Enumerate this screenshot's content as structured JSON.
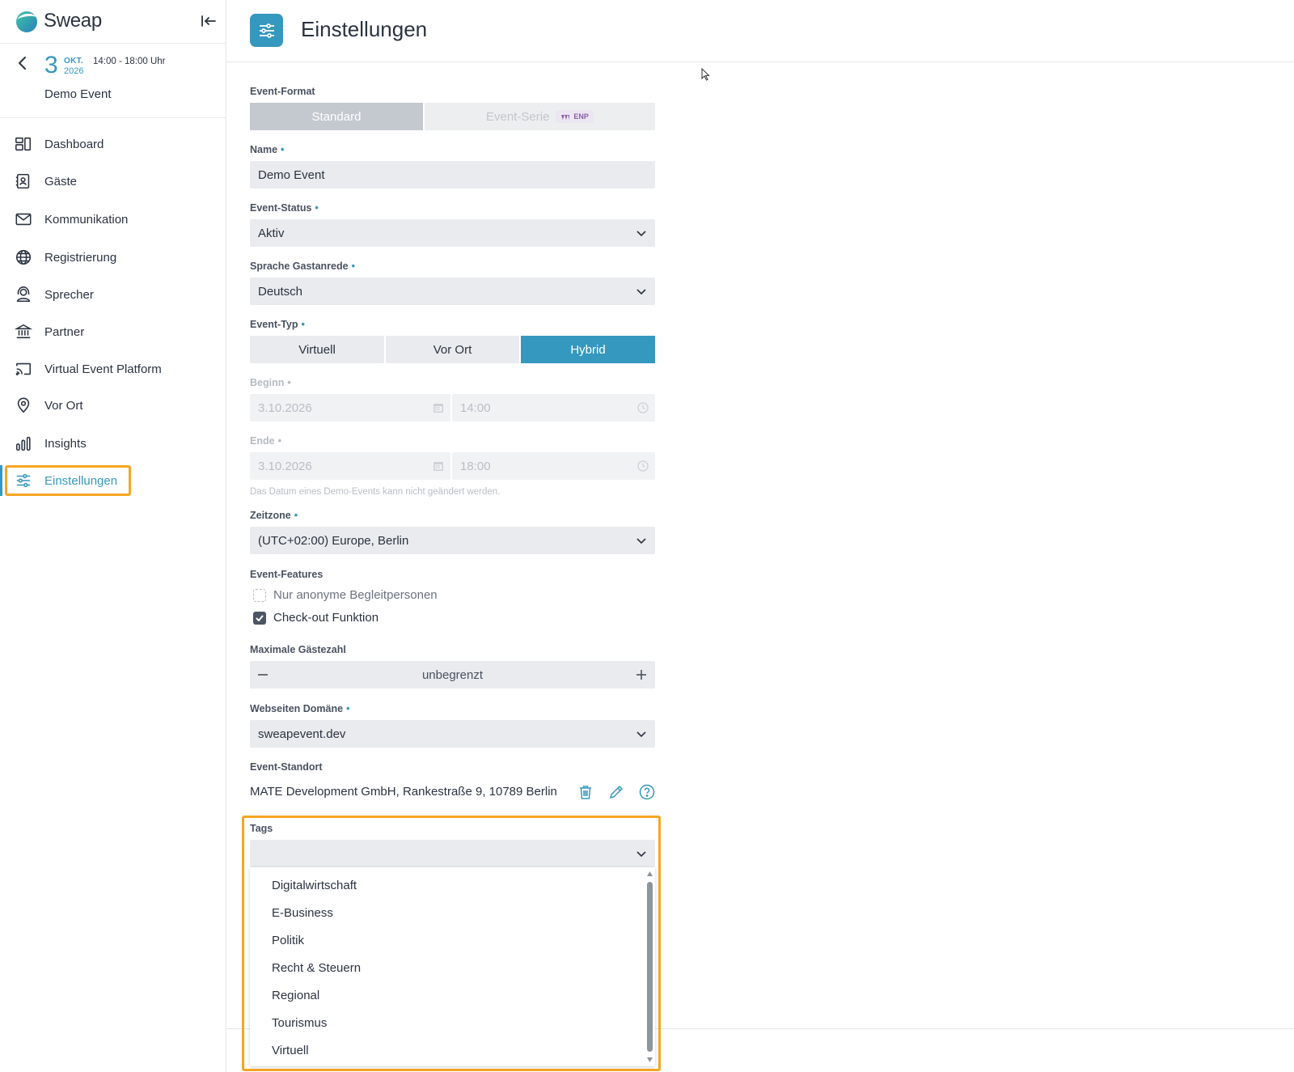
{
  "brand": {
    "name": "Sweap"
  },
  "event": {
    "day": "3",
    "month": "OKT.",
    "year": "2026",
    "time": "14:00 - 18:00 Uhr",
    "name": "Demo Event"
  },
  "nav": {
    "items": [
      {
        "label": "Dashboard",
        "icon": "dashboard-icon"
      },
      {
        "label": "Gäste",
        "icon": "contact-card-icon"
      },
      {
        "label": "Kommunikation",
        "icon": "envelope-icon"
      },
      {
        "label": "Registrierung",
        "icon": "globe-icon"
      },
      {
        "label": "Sprecher",
        "icon": "speaker-icon"
      },
      {
        "label": "Partner",
        "icon": "bank-icon"
      },
      {
        "label": "Virtual Event Platform",
        "icon": "cast-icon"
      },
      {
        "label": "Vor Ort",
        "icon": "location-pin-icon"
      },
      {
        "label": "Insights",
        "icon": "bar-chart-icon"
      },
      {
        "label": "Einstellungen",
        "icon": "sliders-icon"
      }
    ],
    "active": "Einstellungen"
  },
  "page": {
    "title": "Einstellungen"
  },
  "form": {
    "event_format": {
      "label": "Event-Format",
      "options": [
        "Standard",
        "Event-Serie"
      ],
      "badge": "ENP",
      "selected": "Standard"
    },
    "name": {
      "label": "Name",
      "value": "Demo Event"
    },
    "status": {
      "label": "Event-Status",
      "value": "Aktiv"
    },
    "language": {
      "label": "Sprache Gastanrede",
      "value": "Deutsch"
    },
    "event_type": {
      "label": "Event-Typ",
      "options": [
        "Virtuell",
        "Vor Ort",
        "Hybrid"
      ],
      "selected": "Hybrid"
    },
    "begin": {
      "label": "Beginn",
      "date": "3.10.2026",
      "time": "14:00"
    },
    "end": {
      "label": "Ende",
      "date": "3.10.2026",
      "time": "18:00"
    },
    "date_hint": "Das Datum eines Demo-Events kann nicht geändert werden.",
    "timezone": {
      "label": "Zeitzone",
      "value": "(UTC+02:00) Europe, Berlin"
    },
    "features": {
      "label": "Event-Features",
      "items": [
        {
          "label": "Nur anonyme Begleitpersonen",
          "checked": false
        },
        {
          "label": "Check-out Funktion",
          "checked": true
        }
      ]
    },
    "max_guests": {
      "label": "Maximale Gästezahl",
      "value": "unbegrenzt"
    },
    "domain": {
      "label": "Webseiten Domäne",
      "value": "sweapevent.dev"
    },
    "location": {
      "label": "Event-Standort",
      "value": "MATE Development GmbH, Rankestraße 9, 10789 Berlin"
    },
    "tags": {
      "label": "Tags",
      "value": "",
      "options": [
        "Digitalwirtschaft",
        "E-Business",
        "Politik",
        "Recht & Steuern",
        "Regional",
        "Tourismus",
        "Virtuell"
      ]
    }
  },
  "colors": {
    "accent": "#3598be",
    "highlight": "#f5a623",
    "field_bg": "#e9ebee",
    "segment_inactive": "#e9ebee",
    "segment_selected_format": "#c4c9cf",
    "badge_purple": "#8a5fa6"
  }
}
